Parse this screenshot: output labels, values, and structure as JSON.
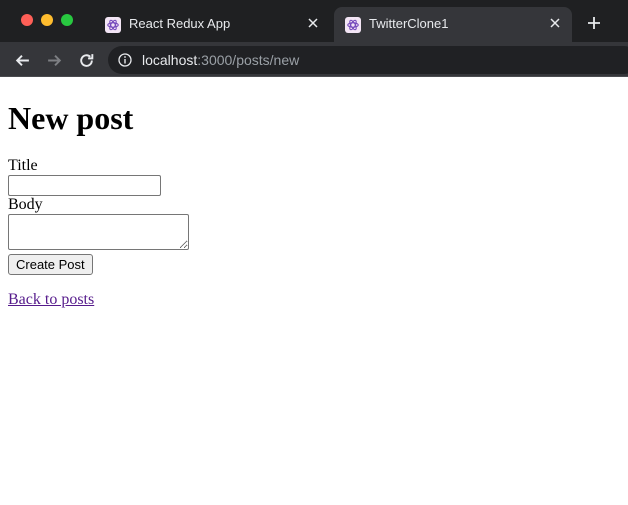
{
  "browser": {
    "tabs": [
      {
        "title": "React Redux App",
        "active": false,
        "favicon": "redux-icon"
      },
      {
        "title": "TwitterClone1",
        "active": true,
        "favicon": "redux-icon"
      }
    ],
    "address_bar": {
      "host": "localhost",
      "path": ":3000/posts/new"
    },
    "colors": {
      "tabbar": "#1f2022",
      "toolbar": "#35363a",
      "omnibox": "#202124",
      "close": "#fe5f57",
      "minimize": "#febc2e",
      "maximize": "#28c840"
    }
  },
  "page": {
    "title": "New post",
    "form": {
      "title_label": "Title",
      "title_value": "",
      "body_label": "Body",
      "body_value": "",
      "submit_label": "Create Post"
    },
    "back_link": "Back to posts",
    "link_color": "#551a8b"
  }
}
